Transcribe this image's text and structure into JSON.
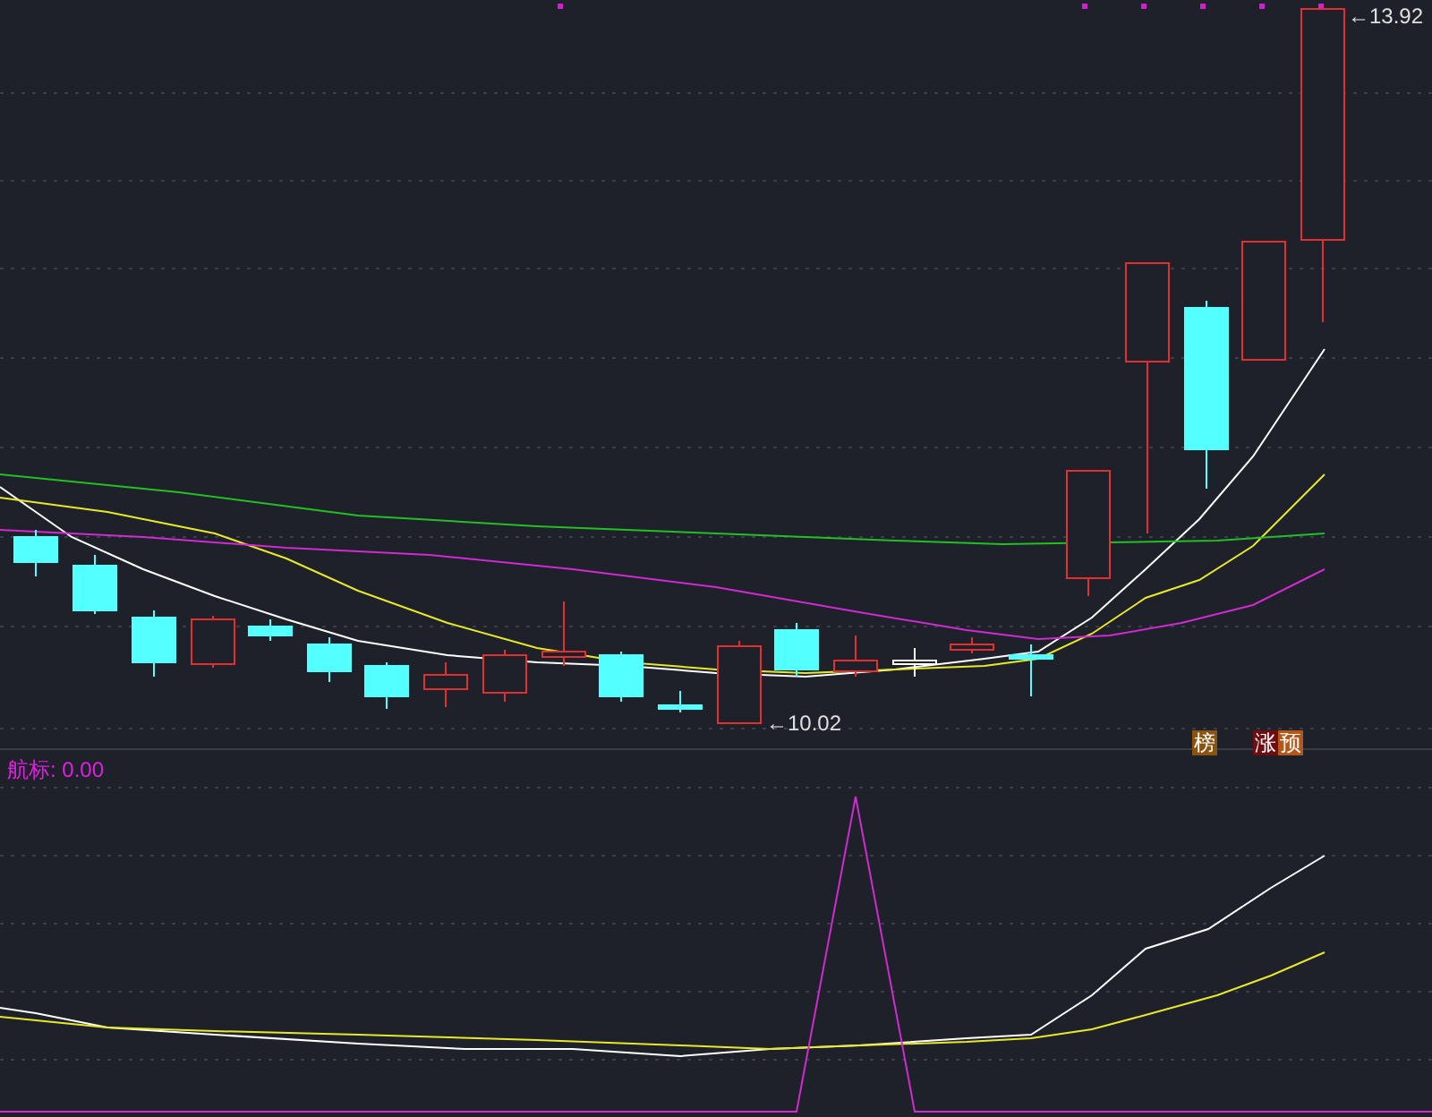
{
  "price_panel": {
    "high_label": "←13.92",
    "low_label": "←10.02",
    "badges": [
      {
        "text": "榜",
        "color": "#8a5410"
      },
      {
        "text": "涨",
        "color": "#6e0e12"
      },
      {
        "text": "预",
        "color": "#b5561a"
      }
    ]
  },
  "indicator_panel": {
    "label": "航标: 0.00"
  }
}
